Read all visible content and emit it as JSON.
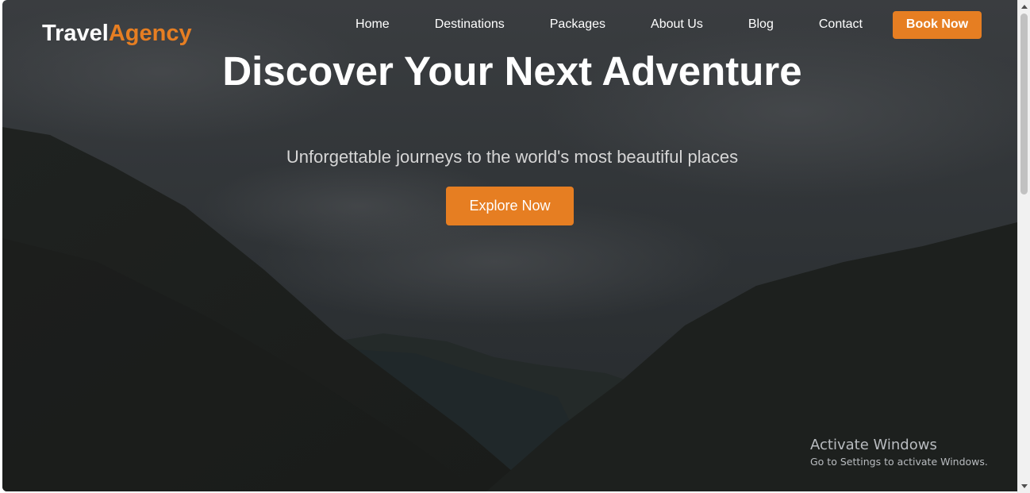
{
  "brand": {
    "name_main": "Travel",
    "name_accent": "Agency",
    "accent_color": "#e67e22"
  },
  "nav": {
    "items": [
      {
        "label": "Home"
      },
      {
        "label": "Destinations"
      },
      {
        "label": "Packages"
      },
      {
        "label": "About Us"
      },
      {
        "label": "Blog"
      },
      {
        "label": "Contact"
      }
    ],
    "cta_label": "Book Now"
  },
  "hero": {
    "title": "Discover Your Next Adventure",
    "subtitle": "Unforgettable journeys to the world's most beautiful places",
    "button_label": "Explore Now",
    "background": "mountain valley under cloudy sky"
  },
  "watermark": {
    "title": "Activate Windows",
    "subtitle": "Go to Settings to activate Windows."
  },
  "scrollbar": {
    "position": 0.0
  }
}
